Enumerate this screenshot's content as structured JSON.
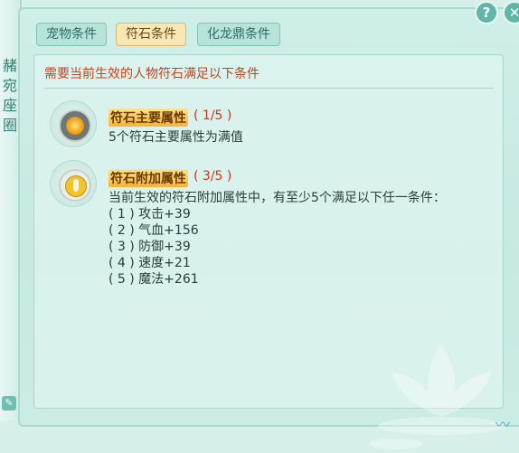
{
  "window": {
    "side_title_chars": [
      "赭",
      "宛",
      "座",
      "圈"
    ],
    "help_glyph": "?",
    "close_glyph": "✕",
    "edit_glyph": "✎"
  },
  "tabs": [
    {
      "label": "宠物条件",
      "active": false
    },
    {
      "label": "符石条件",
      "active": true
    },
    {
      "label": "化龙鼎条件",
      "active": false
    }
  ],
  "panel": {
    "header": "需要当前生效的人物符石满足以下条件",
    "sections": [
      {
        "icon": "gem-icon",
        "title": "符石主要属性",
        "count": "( 1/5 )",
        "lines": [
          "5个符石主要属性为满值"
        ]
      },
      {
        "icon": "coin-alert-icon",
        "title": "符石附加属性",
        "count": "( 3/5 )",
        "lines": [
          "当前生效的符石附加属性中，有至少5个满足以下任一条件：",
          "( 1 ) 攻击+39",
          "( 2 ) 气血+156",
          "( 3 ) 防御+39",
          "( 4 ) 速度+21",
          "( 5 ) 魔法+261"
        ]
      }
    ]
  },
  "colors": {
    "header_text": "#c0461f",
    "count_text": "#d7321a",
    "active_tab_bg": "#f7e7b5",
    "tab_bg": "#b6e4da"
  }
}
